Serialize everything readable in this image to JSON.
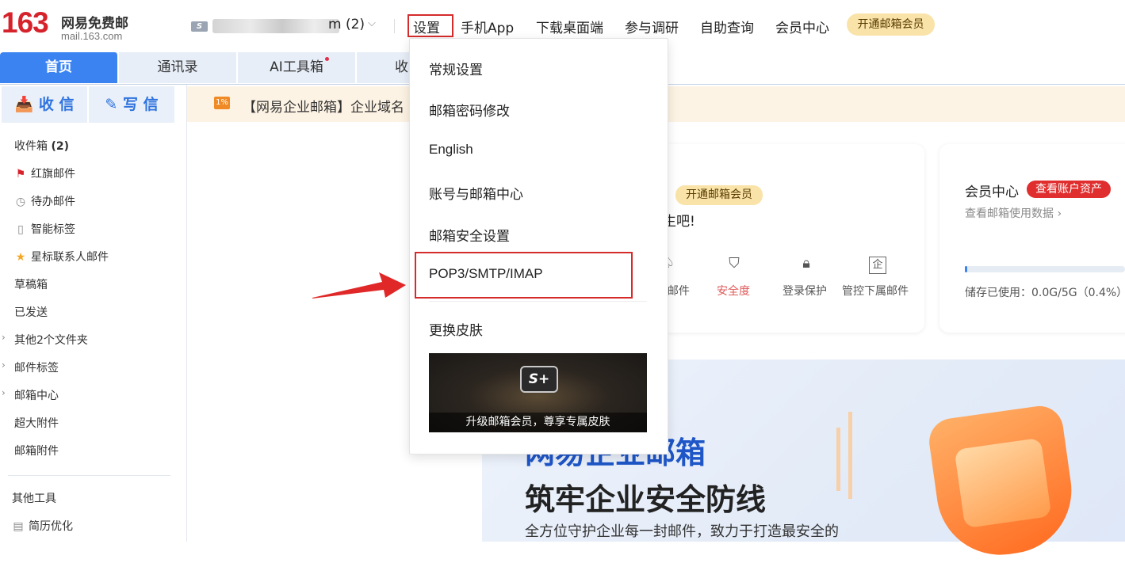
{
  "header": {
    "logo_number": "163",
    "logo_cn": "网易免费邮",
    "logo_en": "mail.163.com",
    "account_icon": "S",
    "account_tail": "m (2)",
    "nav": [
      "设置",
      "手机App",
      "下载桌面端",
      "参与调研",
      "自助查询",
      "会员中心"
    ],
    "vip_button": "开通邮箱会员"
  },
  "tabs": [
    "首页",
    "通讯录",
    "AI工具箱",
    "收"
  ],
  "sidebar": {
    "receive": "收 信",
    "write": "写 信",
    "items": [
      {
        "label": "收件箱",
        "count": "(2)"
      },
      {
        "label": "红旗邮件",
        "icon": "flag-icon"
      },
      {
        "label": "待办邮件",
        "icon": "clock-icon"
      },
      {
        "label": "智能标签",
        "icon": "bookmark-icon"
      },
      {
        "label": "星标联系人邮件",
        "icon": "star-icon"
      },
      {
        "label": "草稿箱"
      },
      {
        "label": "已发送"
      },
      {
        "label": "其他2个文件夹"
      },
      {
        "label": "邮件标签"
      },
      {
        "label": "邮箱中心"
      },
      {
        "label": "超大附件"
      },
      {
        "label": "邮箱附件"
      }
    ],
    "tools_title": "其他工具",
    "tools_items": [
      {
        "label": "简历优化",
        "icon": "resume-icon"
      }
    ]
  },
  "notice": {
    "icon": "1%",
    "text": "【网易企业邮箱】企业域名"
  },
  "card1": {
    "vip_pill": "开通邮箱会员",
    "line": "生吧!",
    "quick": [
      {
        "label": "l邮件",
        "icon": "mail-icon"
      },
      {
        "label": "安全度",
        "icon": "shield-icon"
      },
      {
        "label": "登录保护",
        "icon": "lock-icon"
      },
      {
        "label": "管控下属邮件",
        "icon": "enterprise-icon"
      }
    ]
  },
  "member": {
    "title": "会员中心",
    "badge": "查看账户资产",
    "sub": "查看邮箱使用数据 ›",
    "storage": "储存已使用：0.0G/5G（0.4%）",
    "storage_fraction": 0.004
  },
  "banner": {
    "line1": "网易企业邮箱",
    "line2": "筑牢企业安全防线",
    "line3": "全方位守护企业每一封邮件，致力于打造最安全的"
  },
  "dropdown": {
    "items": [
      "常规设置",
      "邮箱密码修改",
      "English",
      "账号与邮箱中心",
      "邮箱安全设置",
      "POP3/SMTP/IMAP",
      "更换皮肤"
    ],
    "skin_logo": "S+",
    "skin_caption": "升级邮箱会员，尊享专属皮肤"
  },
  "colors": {
    "accent": "#3a83f1",
    "brand_red": "#d6232b",
    "highlight_red": "#d52b2b",
    "vip_gold": "#f9e3a8"
  }
}
